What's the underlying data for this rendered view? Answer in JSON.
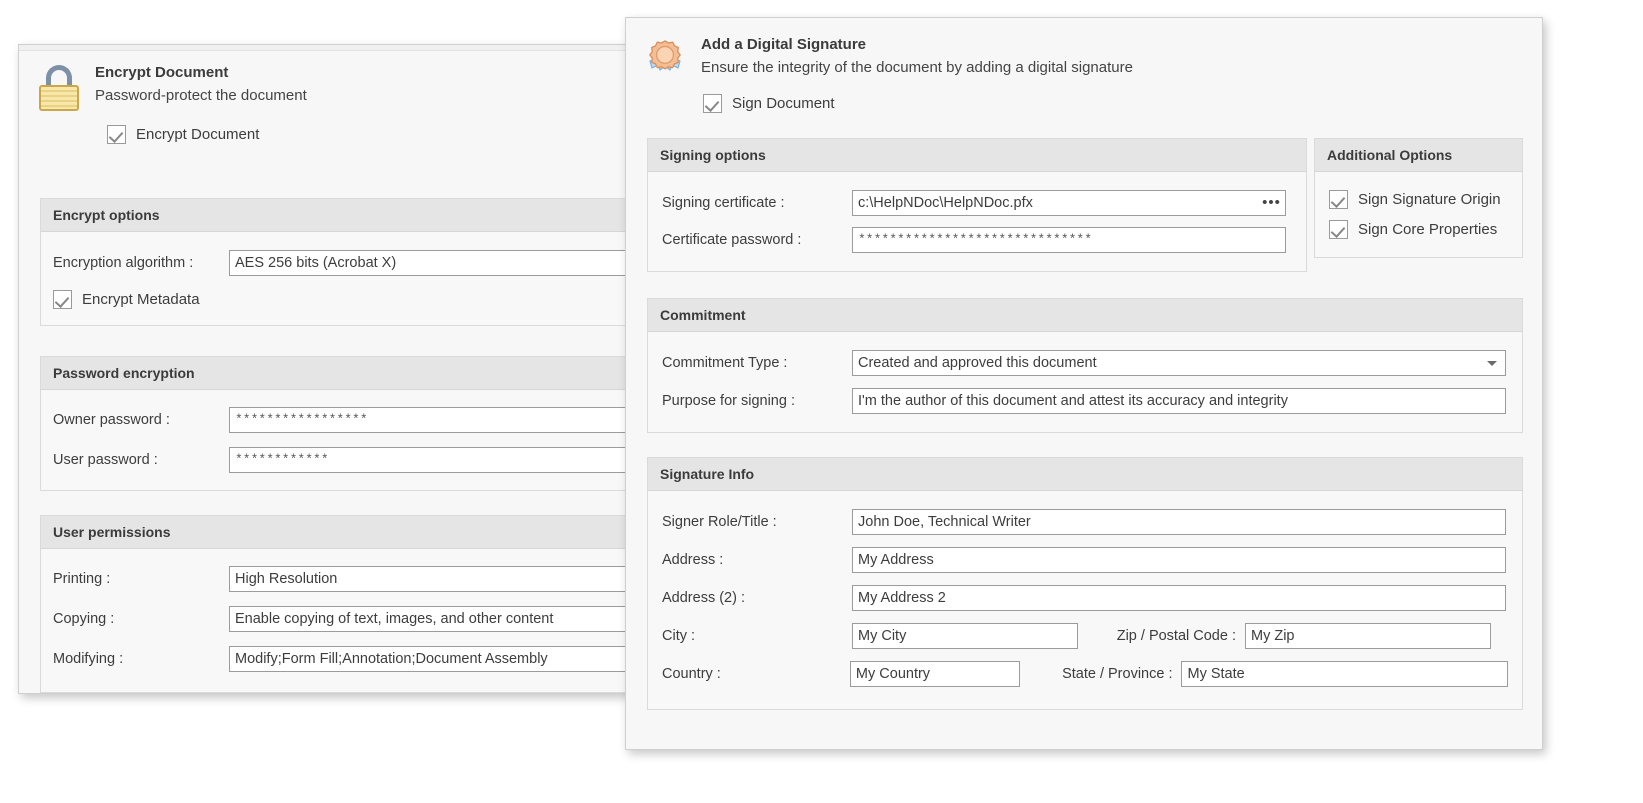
{
  "encrypt_dialog": {
    "icon": "lock-icon",
    "title": "Encrypt Document",
    "subtitle": "Password-protect the document",
    "enable_checkbox_label": "Encrypt Document",
    "enable_checked": true,
    "encrypt_options": {
      "title": "Encrypt options",
      "algorithm_label": "Encryption algorithm :",
      "algorithm_value": "AES 256 bits (Acrobat X)",
      "metadata_checkbox_label": "Encrypt Metadata",
      "metadata_checked": true
    },
    "password_encryption": {
      "title": "Password encryption",
      "owner_label": "Owner password :",
      "owner_value": "*****************",
      "user_label": "User password :",
      "user_value": "************"
    },
    "user_permissions": {
      "title": "User permissions",
      "printing_label": "Printing :",
      "printing_value": "High Resolution",
      "copying_label": "Copying :",
      "copying_value": "Enable copying of text, images, and other content",
      "modifying_label": "Modifying :",
      "modifying_value": "Modify;Form Fill;Annotation;Document Assembly"
    }
  },
  "signature_dialog": {
    "icon": "seal-ribbon-icon",
    "title": "Add a Digital Signature",
    "subtitle": "Ensure the integrity of the document by adding a digital signature",
    "enable_checkbox_label": "Sign Document",
    "enable_checked": true,
    "signing_options": {
      "title": "Signing options",
      "certificate_label": "Signing certificate :",
      "certificate_value": "c:\\HelpNDoc\\HelpNDoc.pfx",
      "browse_button_label": "•••",
      "password_label": "Certificate password :",
      "password_value": "******************************"
    },
    "additional_options": {
      "title": "Additional Options",
      "items": [
        {
          "label": "Sign Signature Origin",
          "checked": true
        },
        {
          "label": "Sign Core Properties",
          "checked": true
        }
      ]
    },
    "commitment": {
      "title": "Commitment",
      "type_label": "Commitment Type :",
      "type_value": "Created and approved this document",
      "purpose_label": "Purpose for signing :",
      "purpose_value": "I'm the author of this document and attest its accuracy and integrity"
    },
    "signature_info": {
      "title": "Signature Info",
      "role_label": "Signer Role/Title :",
      "role_value": "John Doe, Technical Writer",
      "address_label": "Address :",
      "address_value": "My Address",
      "address2_label": "Address (2) :",
      "address2_value": "My Address 2",
      "city_label": "City :",
      "city_value": "My City",
      "zip_label": "Zip / Postal Code :",
      "zip_value": "My Zip",
      "country_label": "Country :",
      "country_value": "My Country",
      "state_label": "State / Province :",
      "state_value": "My State"
    }
  },
  "colors": {
    "group_header": "#e5e5e5",
    "window_bg": "#f7f7f7",
    "field_border": "#9b9b9b",
    "lock_body": "#f0dc95",
    "seal": "#f2b98c"
  }
}
